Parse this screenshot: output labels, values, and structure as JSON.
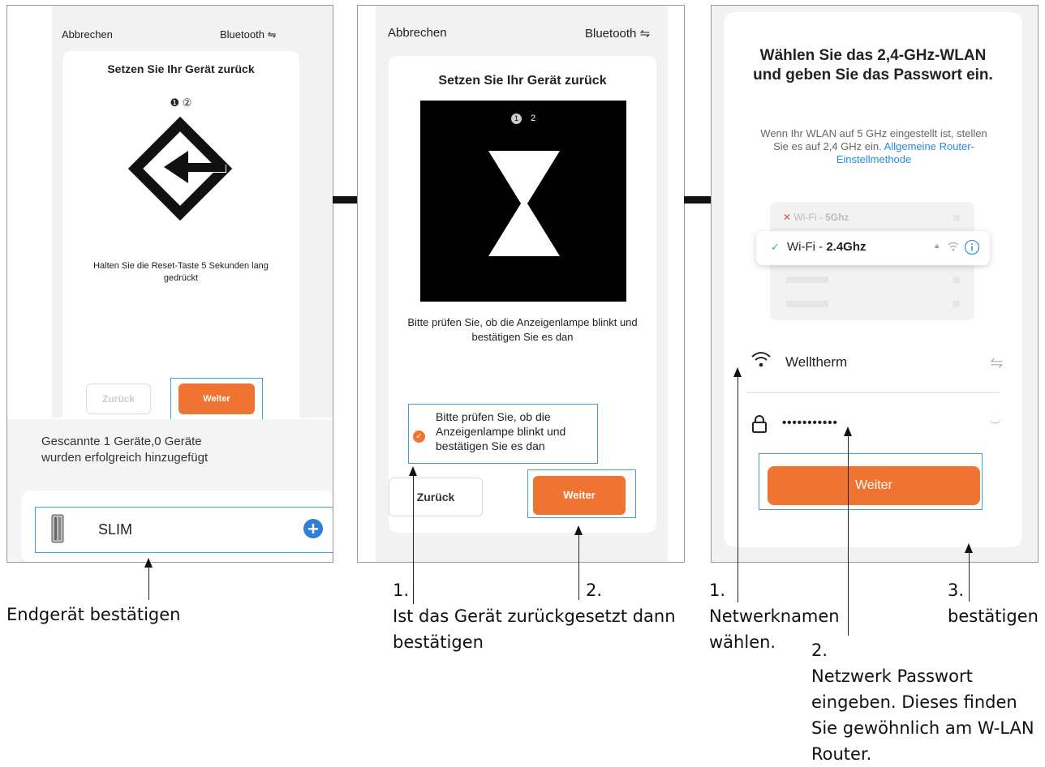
{
  "panel1": {
    "cancel": "Abbrechen",
    "bluetooth": "Bluetooth",
    "bluetooth_icon": "swap-arrows-icon",
    "title": "Setzen Sie Ihr Gerät zurück",
    "steps": "❶ ②",
    "instruction": "Halten Sie die Reset-Taste 5 Sekunden lang gedrückt",
    "back_button": "Zurück",
    "next_button": "Weiter",
    "scan_text": "Gescannte 1 Geräte,0 Geräte wurden erfolgreich hinzugefügt",
    "device_name": "SLIM",
    "add_icon": "plus-circle-icon"
  },
  "panel2": {
    "cancel": "Abbrechen",
    "bluetooth": "Bluetooth",
    "title": "Setzen Sie Ihr Gerät zurück",
    "step_active": "1",
    "step_next": "2",
    "instruction": "Bitte prüfen Sie, ob die Anzeigenlampe blinkt und bestätigen Sie es dan",
    "checkbox_label": "Bitte prüfen Sie, ob die Anzeigenlampe blinkt und bestätigen Sie es dan",
    "back_button": "Zurück",
    "next_button": "Weiter"
  },
  "panel3": {
    "title": "Wählen Sie das 2,4-GHz-WLAN und geben Sie das Passwort ein.",
    "info": "Wenn Ihr WLAN auf 5 GHz eingestellt ist, stellen Sie es auf 2,4 GHz ein.",
    "info_link": "Allgemeine Router-Einstellmethode",
    "wifi5_prefix": "Wi-Fi - ",
    "wifi5_band": "5Ghz",
    "wifi24_prefix": "Wi-Fi - ",
    "wifi24_band": "2.4Ghz",
    "network_name": "Welltherm",
    "password": "•••••••••••",
    "next_button": "Weiter"
  },
  "annotations": {
    "a1": "Endgerät bestätigen",
    "a2_num1": "1.",
    "a2_num2": "2.",
    "a2_text": "Ist das Gerät zurückgesetzt dann bestätigen",
    "a3_num1": "1.",
    "a3_text1": "Netwerknamen wählen.",
    "a3_num2": "2.",
    "a3_text2": "Netzwerk Passwort eingeben. Dieses finden Sie gewöhnlich am W-LAN Router.",
    "a3_num3": "3.",
    "a3_text3": "bestätigen"
  },
  "colors": {
    "accent": "#f07431",
    "link": "#2a8ad8",
    "highlight": "#3aa0d6",
    "check": "#f07431"
  }
}
